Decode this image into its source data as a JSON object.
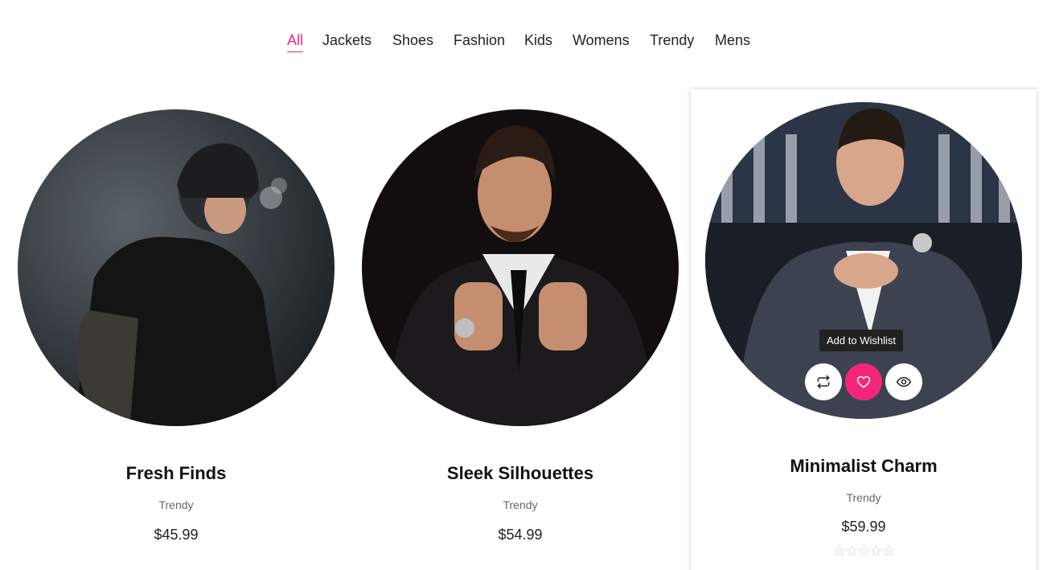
{
  "filters": [
    "All",
    "Jackets",
    "Shoes",
    "Fashion",
    "Kids",
    "Womens",
    "Trendy",
    "Mens"
  ],
  "active_filter": "All",
  "accent_color": "#f5267a",
  "products": [
    {
      "title": "Fresh Finds",
      "category": "Trendy",
      "price": "$45.99"
    },
    {
      "title": "Sleek Silhouettes",
      "category": "Trendy",
      "price": "$54.99"
    },
    {
      "title": "Minimalist Charm",
      "category": "Trendy",
      "price": "$59.99",
      "rating": 0,
      "rating_max": 5
    }
  ],
  "actions": {
    "compare_icon": "compare-arrows-icon",
    "wishlist_icon": "heart-icon",
    "view_icon": "eye-icon",
    "wishlist_tooltip": "Add to Wishlist"
  }
}
